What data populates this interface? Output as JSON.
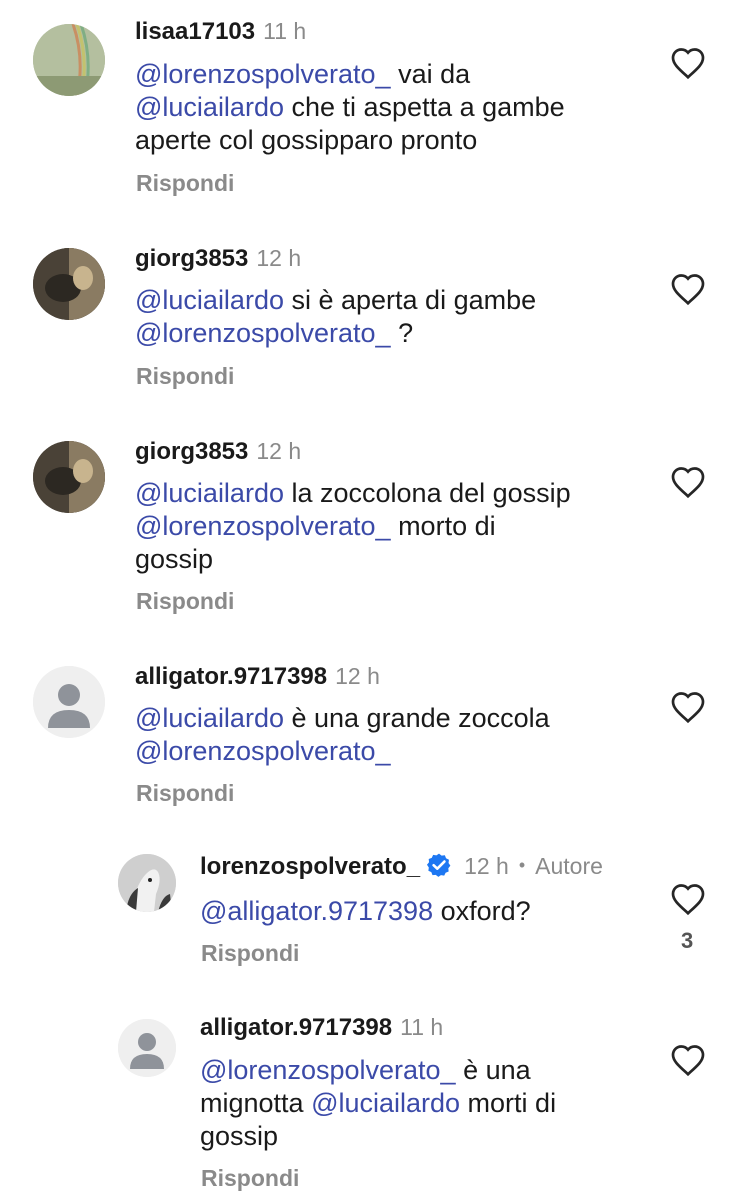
{
  "comments": [
    {
      "username": "lisaa17103",
      "time": "11 h",
      "mention1": "@lorenzospolverato_",
      "text1": " vai da",
      "mention2": "@luciailardo",
      "text2": " che ti aspetta a gambe",
      "text3": "aperte col gossipparo pronto",
      "reply": "Rispondi"
    },
    {
      "username": "giorg3853",
      "time": "12 h",
      "mention1": "@luciailardo",
      "text1": " si è aperta di gambe",
      "mention2": "@lorenzospolverato_",
      "text2": " ?",
      "reply": "Rispondi"
    },
    {
      "username": "giorg3853",
      "time": "12 h",
      "mention1": "@luciailardo",
      "text1": " la zoccolona del gossip",
      "mention2": "@lorenzospolverato_",
      "text2": " morto di",
      "text3": "gossip",
      "reply": "Rispondi"
    },
    {
      "username": "alligator.9717398",
      "time": "12 h",
      "mention1": "@luciailardo",
      "text1": " è una grande zoccola",
      "mention2": "@lorenzospolverato_",
      "reply": "Rispondi"
    },
    {
      "username": "lorenzospolverato_",
      "time": "12 h",
      "separator": "•",
      "author_label": "Autore",
      "mention1": "@alligator.9717398",
      "text1": " oxford?",
      "reply": "Rispondi",
      "like_count": "3"
    },
    {
      "username": "alligator.9717398",
      "time": "11 h",
      "mention1": "@lorenzospolverato_",
      "text1": " è una",
      "text2a": "mignotta ",
      "mention2": "@luciailardo",
      "text2b": " morti di",
      "text3": "gossip",
      "reply": "Rispondi"
    }
  ],
  "icons": {
    "like": "heart-outline-icon",
    "verified": "verified-badge-icon",
    "default_avatar": "default-user-silhouette"
  },
  "colors": {
    "mention": "#3b4aa8",
    "secondary_text": "#8a8a8a",
    "verified": "#1d77f2"
  }
}
